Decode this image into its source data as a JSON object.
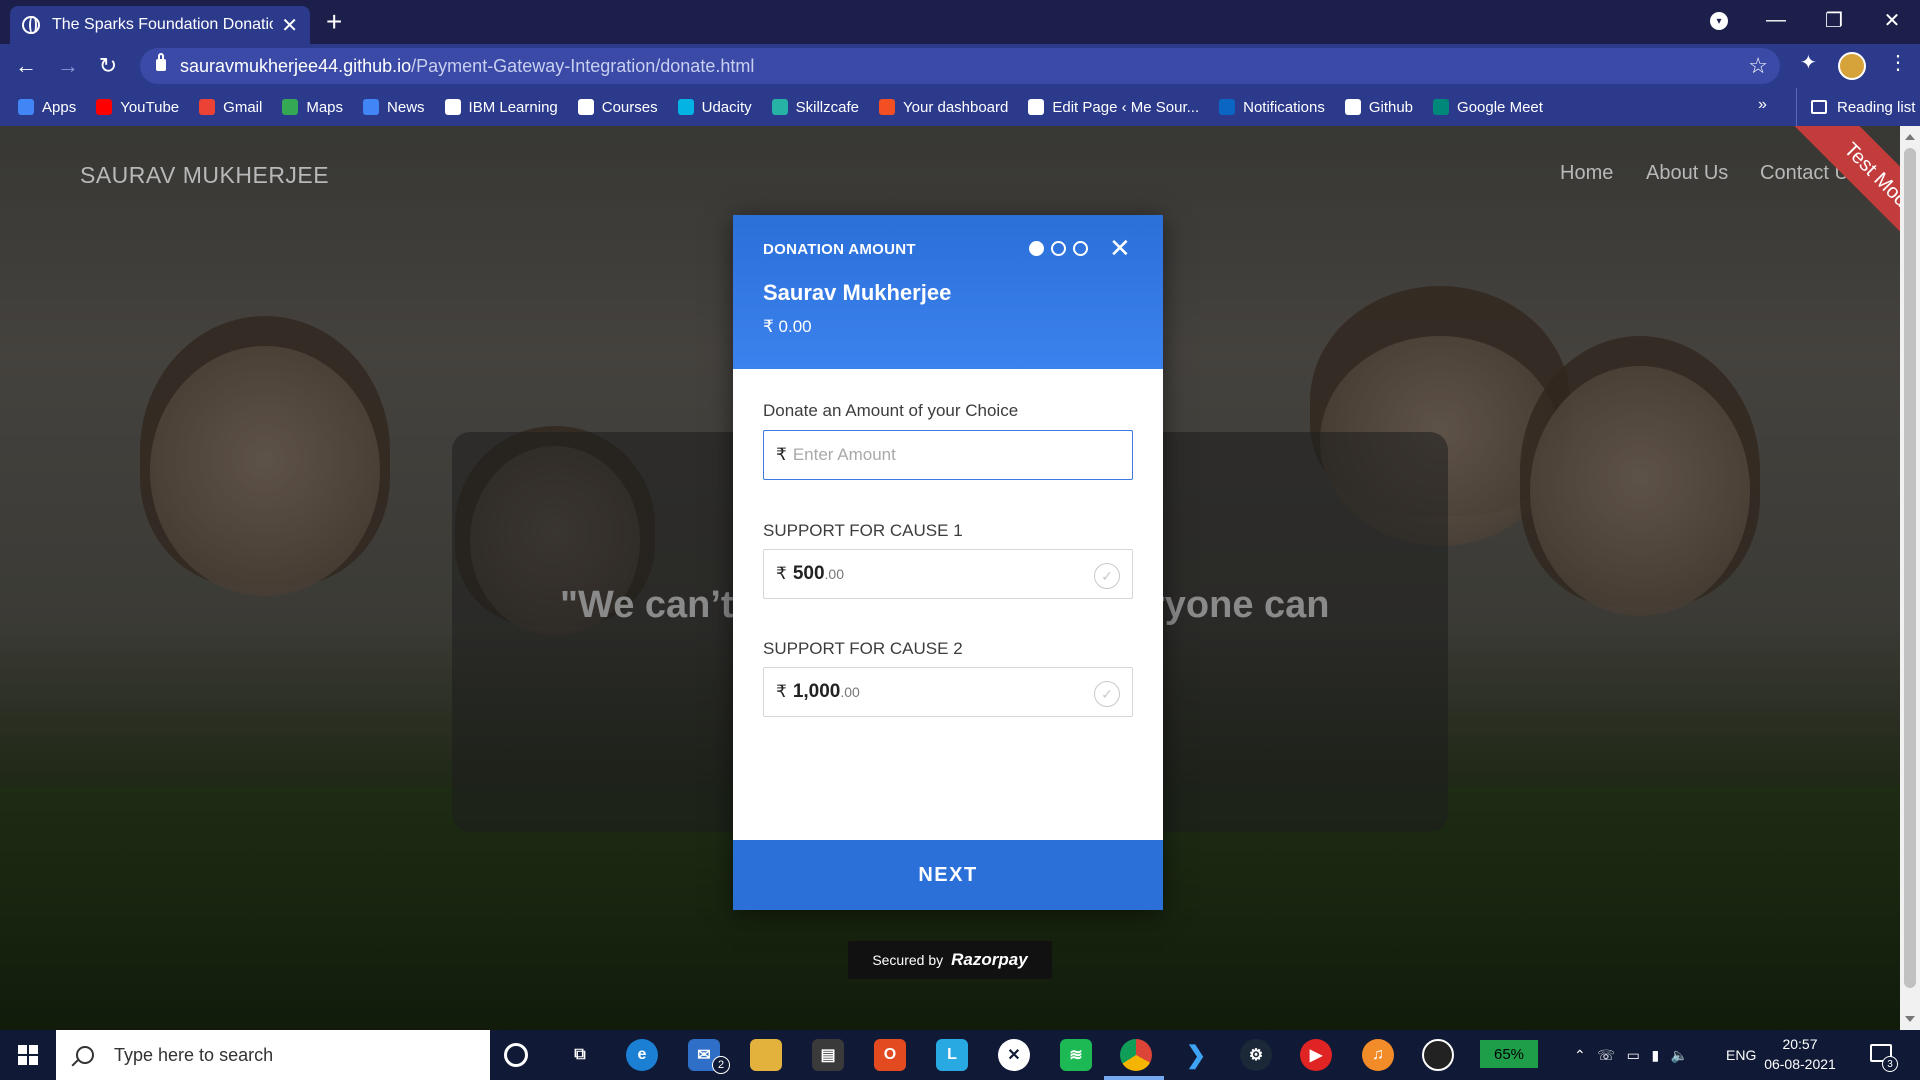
{
  "browser": {
    "tab_title": "The Sparks Foundation Donation",
    "url_host": "sauravmukherjee44.github.io",
    "url_path": "/Payment-Gateway-Integration/donate.html",
    "bookmarks": [
      {
        "label": "Apps",
        "icon": "apps-grid-icon",
        "color": "#4285f4"
      },
      {
        "label": "YouTube",
        "icon": "youtube-icon",
        "color": "#ff0000"
      },
      {
        "label": "Gmail",
        "icon": "gmail-icon",
        "color": "#ea4335"
      },
      {
        "label": "Maps",
        "icon": "maps-icon",
        "color": "#34a853"
      },
      {
        "label": "News",
        "icon": "news-icon",
        "color": "#4285f4"
      },
      {
        "label": "IBM Learning",
        "icon": "ibm-icon",
        "color": "#ffffff"
      },
      {
        "label": "Courses",
        "icon": "courses-icon",
        "color": "#ffffff"
      },
      {
        "label": "Udacity",
        "icon": "udacity-icon",
        "color": "#02b3e4"
      },
      {
        "label": "Skillzcafe",
        "icon": "skillzcafe-icon",
        "color": "#26b3a6"
      },
      {
        "label": "Your dashboard",
        "icon": "microsoft-icon",
        "color": "#f25022"
      },
      {
        "label": "Edit Page ‹ Me Sour...",
        "icon": "wordpress-icon",
        "color": "#ffffff"
      },
      {
        "label": "Notifications",
        "icon": "linkedin-icon",
        "color": "#0a66c2"
      },
      {
        "label": "Github",
        "icon": "github-icon",
        "color": "#ffffff"
      },
      {
        "label": "Google Meet",
        "icon": "meet-icon",
        "color": "#00897b"
      }
    ],
    "bookmarks_more": "»",
    "reading_list": "Reading list"
  },
  "site": {
    "brand": "SAURAV MUKHERJEE",
    "nav": [
      "Home",
      "About Us",
      "Contact Us"
    ],
    "quote_left": "\"We can’t",
    "quote_right": "ryone can",
    "test_mode": "Test Mode"
  },
  "modal": {
    "header_title": "DONATION AMOUNT",
    "step": 1,
    "steps_total": 3,
    "payee_name": "Saurav Mukherjee",
    "amount": "₹ 0.00",
    "custom_label": "Donate an Amount of your Choice",
    "custom_placeholder": "Enter Amount",
    "currency": "₹",
    "cause1_label": "SUPPORT FOR CAUSE 1",
    "cause1_main": "500",
    "cause1_dec": ".00",
    "cause2_label": "SUPPORT FOR CAUSE 2",
    "cause2_main": "1,000",
    "cause2_dec": ".00",
    "next_label": "NEXT",
    "secured_by": "Secured by",
    "razorpay": "Razorpay"
  },
  "taskbar": {
    "search_placeholder": "Type here to search",
    "mail_badge": "2",
    "battery": "65%",
    "language": "ENG",
    "time": "20:57",
    "date": "06-08-2021",
    "notifications": "3"
  }
}
